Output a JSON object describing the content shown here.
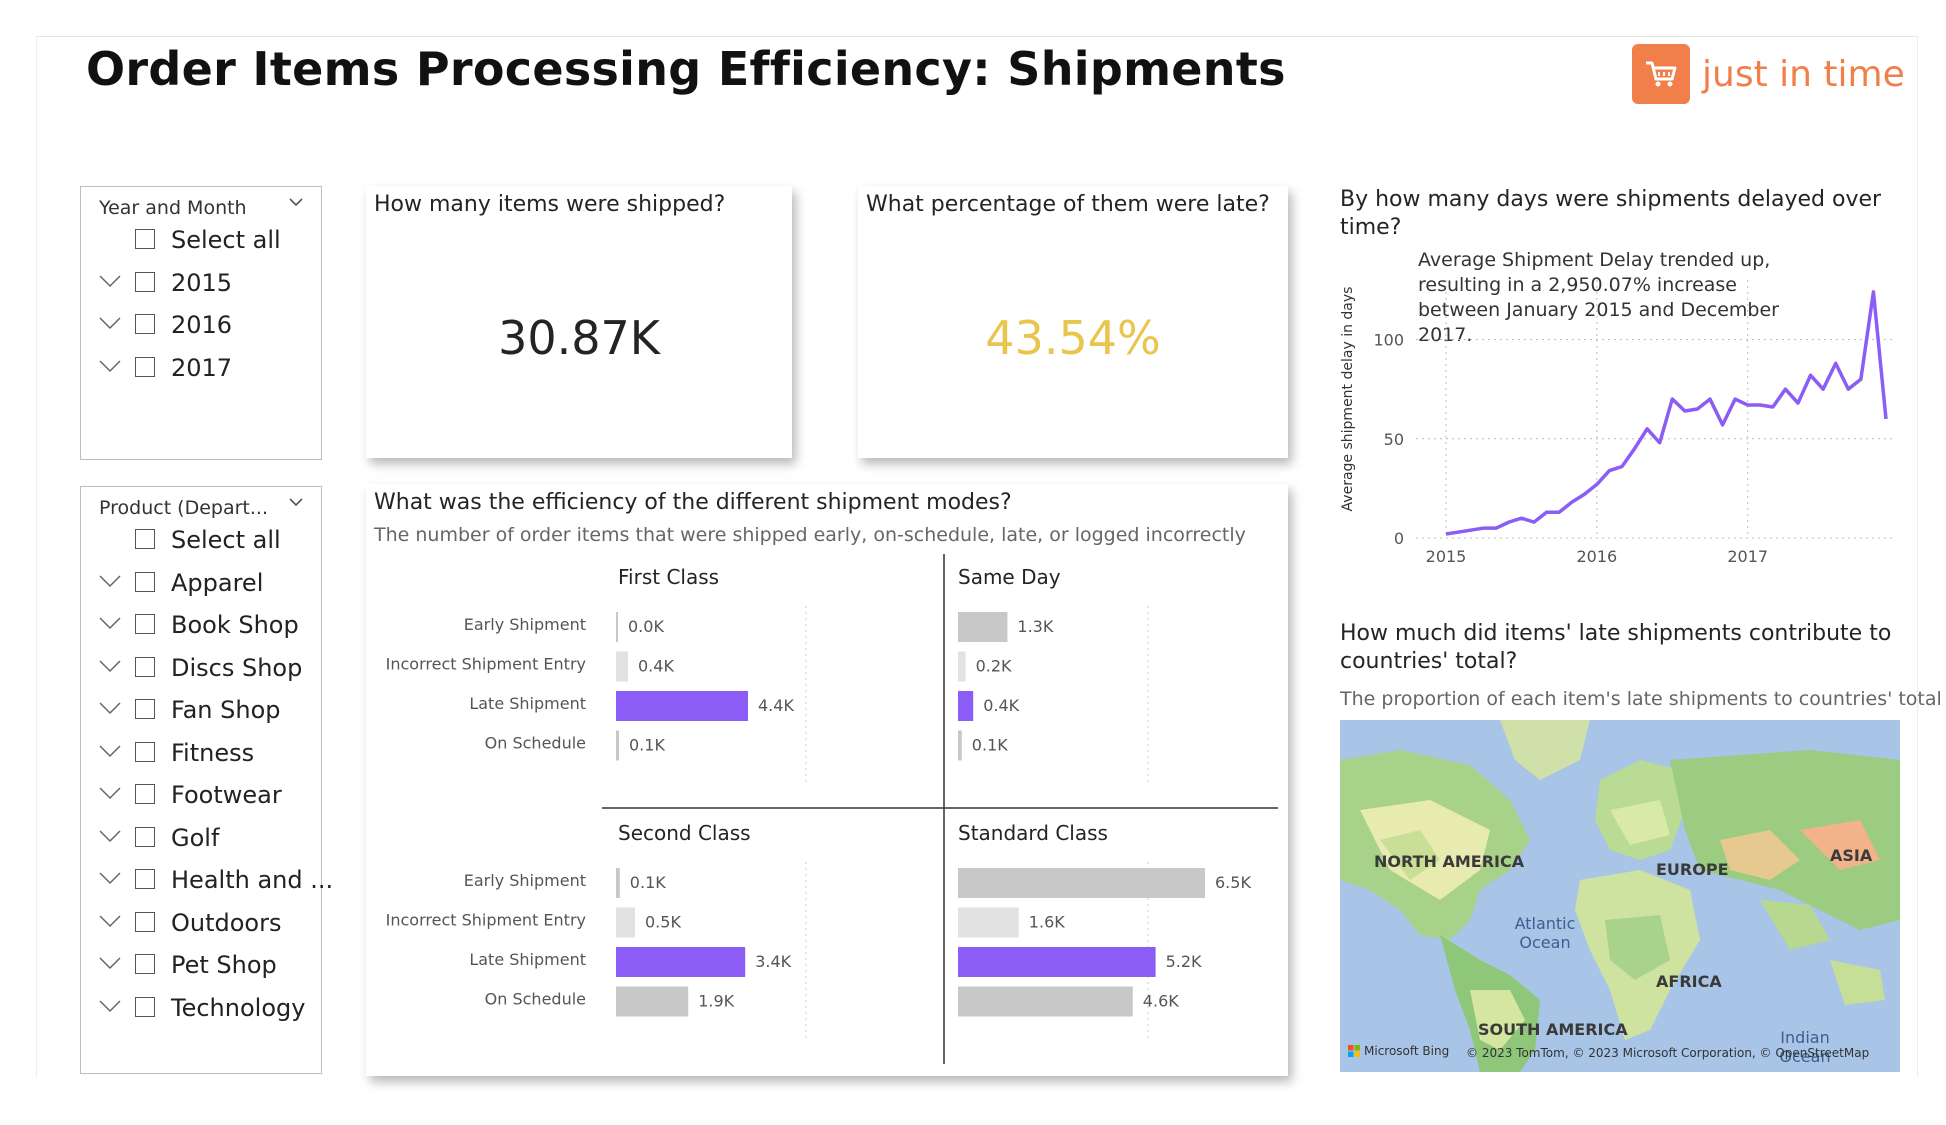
{
  "header": {
    "title": "Order Items Processing Efficiency: Shipments",
    "logo_text": "just in time",
    "logo_color": "#f07f4a"
  },
  "slicers": {
    "year_month": {
      "title": "Year and Month",
      "items": [
        {
          "label": "Select all",
          "expandable": false
        },
        {
          "label": "2015",
          "expandable": true
        },
        {
          "label": "2016",
          "expandable": true
        },
        {
          "label": "2017",
          "expandable": true
        }
      ]
    },
    "product": {
      "title": "Product (Depart...",
      "items": [
        {
          "label": "Select all",
          "expandable": false
        },
        {
          "label": "Apparel",
          "expandable": true
        },
        {
          "label": "Book Shop",
          "expandable": true
        },
        {
          "label": "Discs Shop",
          "expandable": true
        },
        {
          "label": "Fan Shop",
          "expandable": true
        },
        {
          "label": "Fitness",
          "expandable": true
        },
        {
          "label": "Footwear",
          "expandable": true
        },
        {
          "label": "Golf",
          "expandable": true
        },
        {
          "label": "Health and ...",
          "expandable": true
        },
        {
          "label": "Outdoors",
          "expandable": true
        },
        {
          "label": "Pet Shop",
          "expandable": true
        },
        {
          "label": "Technology",
          "expandable": true
        }
      ]
    }
  },
  "kpis": {
    "shipped": {
      "question": "How many items were shipped?",
      "value": "30.87K",
      "color": "#252423"
    },
    "late": {
      "question": "What percentage of them were late?",
      "value": "43.54%",
      "color": "#e8c54c"
    }
  },
  "modes_card": {
    "title": "What was the efficiency of the different shipment modes?",
    "subtitle": "The number of order items that were shipped early, on-schedule, late, or logged incorrectly"
  },
  "colors": {
    "late": "#8b5cf6",
    "gray": "#c8c8c8",
    "light_gray": "#e2e2e2",
    "line": "#8b5cf6"
  },
  "right": {
    "delay_title": "By how many days were shipments delayed over time?",
    "delay_annotation": "Average Shipment Delay trended up, resulting in a 2,950.07% increase between January 2015 and December 2017.",
    "map_title": "How much did items' late shipments contribute to countries' total?",
    "map_subtitle": "The proportion of each item's late shipments to countries' total",
    "map_labels": {
      "north_america": "NORTH AMERICA",
      "europe": "EUROPE",
      "asia": "ASIA",
      "africa": "AFRICA",
      "south_america": "SOUTH AMERICA",
      "atlantic": "Atlantic Ocean",
      "indian": "Indian Ocean",
      "bing": "Microsoft Bing",
      "attribution": "© 2023 TomTom, © 2023 Microsoft Corporation, © OpenStreetMap"
    }
  },
  "chart_data": [
    {
      "type": "bar",
      "orientation": "horizontal",
      "title": "First Class",
      "categories": [
        "Early Shipment",
        "Incorrect Shipment Entry",
        "Late Shipment",
        "On Schedule"
      ],
      "values": [
        0.0,
        0.4,
        4.4,
        0.1
      ],
      "labels": [
        "0.0K",
        "0.4K",
        "4.4K",
        "0.1K"
      ],
      "unit": "K"
    },
    {
      "type": "bar",
      "orientation": "horizontal",
      "title": "Same Day",
      "categories": [
        "Early Shipment",
        "Incorrect Shipment Entry",
        "Late Shipment",
        "On Schedule"
      ],
      "values": [
        1.3,
        0.2,
        0.4,
        0.1
      ],
      "labels": [
        "1.3K",
        "0.2K",
        "0.4K",
        "0.1K"
      ],
      "unit": "K"
    },
    {
      "type": "bar",
      "orientation": "horizontal",
      "title": "Second Class",
      "categories": [
        "Early Shipment",
        "Incorrect Shipment Entry",
        "Late Shipment",
        "On Schedule"
      ],
      "values": [
        0.1,
        0.5,
        3.4,
        1.9
      ],
      "labels": [
        "0.1K",
        "0.5K",
        "3.4K",
        "1.9K"
      ],
      "unit": "K"
    },
    {
      "type": "bar",
      "orientation": "horizontal",
      "title": "Standard Class",
      "categories": [
        "Early Shipment",
        "Incorrect Shipment Entry",
        "Late Shipment",
        "On Schedule"
      ],
      "values": [
        6.5,
        1.6,
        5.2,
        4.6
      ],
      "labels": [
        "6.5K",
        "1.6K",
        "5.2K",
        "4.6K"
      ],
      "unit": "K"
    },
    {
      "type": "line",
      "ylabel": "Average shipment delay in days",
      "xlabel": "",
      "xticks": [
        "2015",
        "2016",
        "2017"
      ],
      "yticks": [
        0,
        50,
        100
      ],
      "ylim": [
        0,
        130
      ],
      "x": [
        "2015-01",
        "2015-02",
        "2015-03",
        "2015-04",
        "2015-05",
        "2015-06",
        "2015-07",
        "2015-08",
        "2015-09",
        "2015-10",
        "2015-11",
        "2015-12",
        "2016-01",
        "2016-02",
        "2016-03",
        "2016-04",
        "2016-05",
        "2016-06",
        "2016-07",
        "2016-08",
        "2016-09",
        "2016-10",
        "2016-11",
        "2016-12",
        "2017-01",
        "2017-02",
        "2017-03",
        "2017-04",
        "2017-05",
        "2017-06",
        "2017-07",
        "2017-08",
        "2017-09",
        "2017-10",
        "2017-11",
        "2017-12"
      ],
      "series": [
        {
          "values": [
            2,
            3,
            4,
            5,
            5,
            8,
            10,
            8,
            13,
            13,
            18,
            22,
            27,
            34,
            36,
            45,
            55,
            48,
            70,
            64,
            65,
            70,
            57,
            70,
            67,
            67,
            66,
            75,
            68,
            82,
            75,
            88,
            75,
            80,
            124,
            60
          ]
        }
      ],
      "grid": true
    }
  ]
}
